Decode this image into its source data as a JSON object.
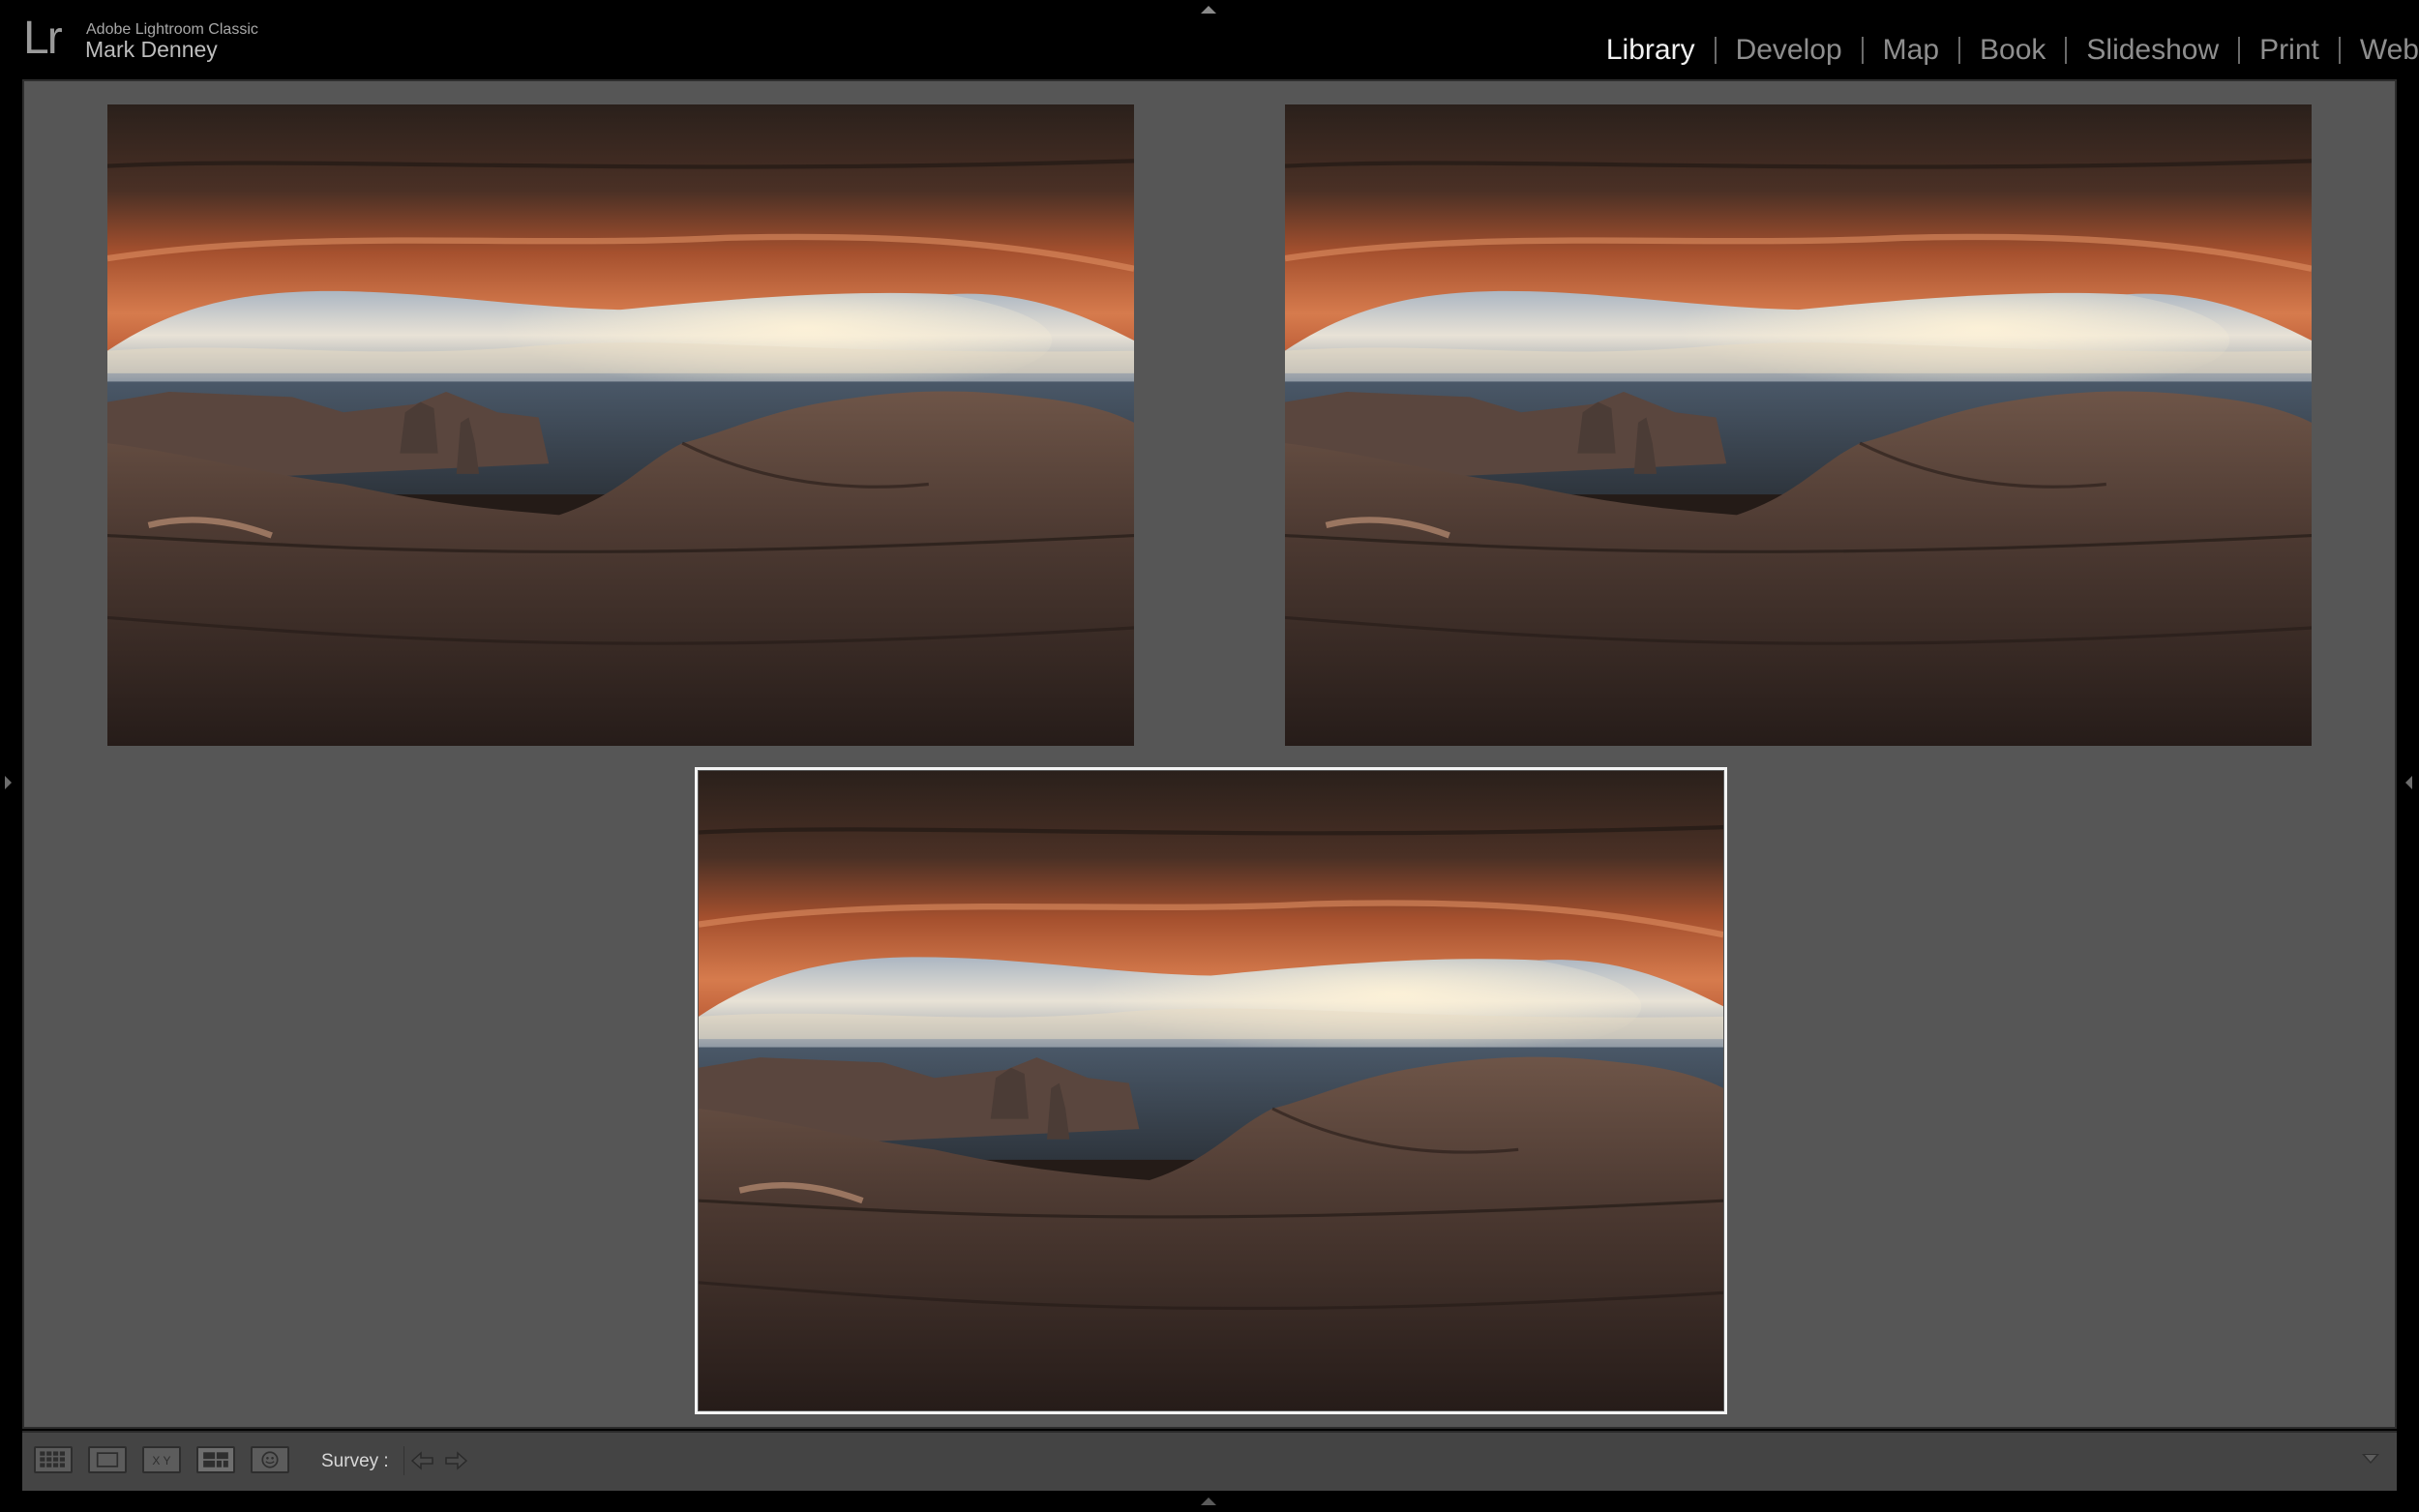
{
  "identity": {
    "logo": "Lr",
    "app_name": "Adobe Lightroom Classic",
    "user_name": "Mark Denney"
  },
  "modules": [
    {
      "label": "Library",
      "active": true
    },
    {
      "label": "Develop",
      "active": false
    },
    {
      "label": "Map",
      "active": false
    },
    {
      "label": "Book",
      "active": false
    },
    {
      "label": "Slideshow",
      "active": false
    },
    {
      "label": "Print",
      "active": false
    },
    {
      "label": "Web",
      "active": false
    }
  ],
  "survey": {
    "photos": [
      {
        "subject": "Mesa Arch sunrise",
        "selected": false
      },
      {
        "subject": "Mesa Arch sunrise",
        "selected": false
      },
      {
        "subject": "Mesa Arch sunrise",
        "selected": true
      }
    ]
  },
  "toolbar": {
    "view_buttons": [
      {
        "icon": "grid-view-icon"
      },
      {
        "icon": "loupe-view-icon"
      },
      {
        "icon": "compare-view-icon",
        "text": "X Y"
      },
      {
        "icon": "survey-view-icon"
      },
      {
        "icon": "people-view-icon"
      }
    ],
    "mode_label": "Survey :",
    "nav_icons": [
      "arrow-left-icon",
      "arrow-right-icon"
    ]
  },
  "colors": {
    "background": "#000000",
    "viewer": "#565656",
    "toolbar": "#444444",
    "active_module": "#f2f2f2",
    "inactive_module": "#8e8e8e",
    "selection_border": "#f4f4f4"
  }
}
